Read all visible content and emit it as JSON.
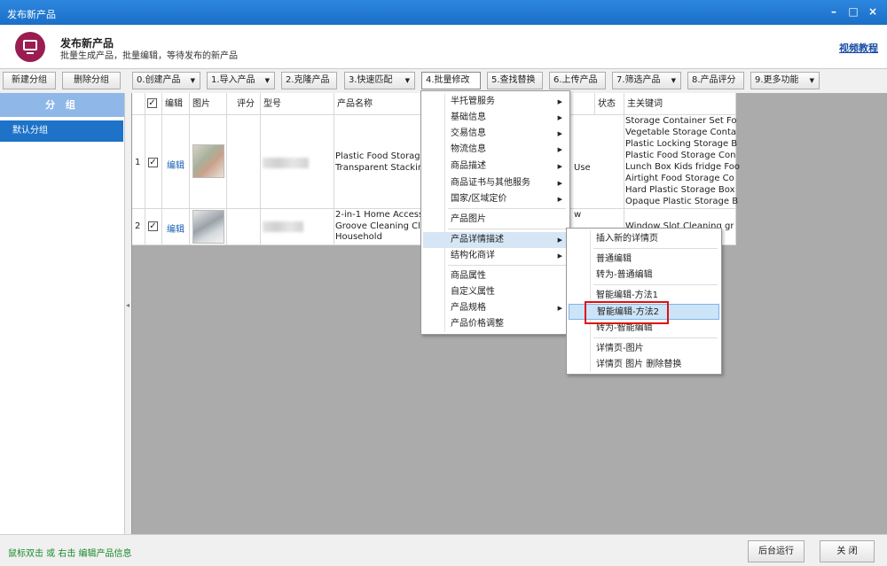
{
  "window": {
    "title": "发布新产品",
    "minimize": "–",
    "maximize": "□",
    "close": "×"
  },
  "header": {
    "title": "发布新产品",
    "subtitle": "批量生成产品，批量编辑，等待发布的新产品",
    "help_link": "视频教程"
  },
  "left_toolbar": {
    "new_group": "新建分组",
    "delete_group": "删除分组"
  },
  "toolbar": [
    {
      "label": "0.创建产品",
      "dropdown": true
    },
    {
      "label": "1.导入产品",
      "dropdown": true
    },
    {
      "label": "2.克隆产品",
      "dropdown": false
    },
    {
      "label": "3.快速匹配",
      "dropdown": true
    },
    {
      "label": "4.批量修改",
      "dropdown": false
    },
    {
      "label": "5.查找替换",
      "dropdown": false
    },
    {
      "label": "6.上传产品",
      "dropdown": false
    },
    {
      "label": "7.筛选产品",
      "dropdown": true
    },
    {
      "label": "8.产品评分",
      "dropdown": false
    },
    {
      "label": "9.更多功能",
      "dropdown": true
    }
  ],
  "groups": {
    "header": "分 组",
    "items": [
      "默认分组"
    ]
  },
  "table": {
    "headers": {
      "edit": "编辑",
      "image": "图片",
      "score": "评分",
      "model": "型号",
      "name": "产品名称",
      "status": "状态",
      "keywords": "主关键词"
    },
    "header_checked": true,
    "rows": [
      {
        "index": "1",
        "checked": true,
        "edit": "编辑",
        "name_lines": [
          "Plastic Food Storage",
          "Transparent Stacking"
        ],
        "extra": "Use",
        "keywords": [
          "Storage Container Set Fo",
          "Vegetable Storage Conta",
          "Plastic Locking Storage B",
          "Plastic Food Storage Con",
          "Lunch Box Kids fridge Foo",
          "Airtight Food Storage Co",
          "Hard Plastic Storage Box",
          "Opaque Plastic Storage B"
        ]
      },
      {
        "index": "2",
        "checked": true,
        "edit": "编辑",
        "name_lines": [
          "2-in-1 Home Access",
          "Groove Cleaning Clo",
          "Household"
        ],
        "extra": "w",
        "keywords": [
          "Window Slot Cleaning gr"
        ]
      }
    ]
  },
  "context_menu": {
    "items": [
      {
        "label": "半托管服务",
        "submenu": true
      },
      {
        "label": "基础信息",
        "submenu": true
      },
      {
        "label": "交易信息",
        "submenu": true
      },
      {
        "label": "物流信息",
        "submenu": true
      },
      {
        "label": "商品描述",
        "submenu": true
      },
      {
        "label": "商品证书与其他服务",
        "submenu": true
      },
      {
        "label": "国家/区域定价",
        "submenu": true
      },
      {
        "label": "产品图片",
        "submenu": false
      },
      {
        "label": "产品详情描述",
        "submenu": true
      },
      {
        "label": "结构化商详",
        "submenu": true
      },
      {
        "label": "商品属性",
        "submenu": false
      },
      {
        "label": "自定义属性",
        "submenu": false
      },
      {
        "label": "产品规格",
        "submenu": true
      },
      {
        "label": "产品价格调整",
        "submenu": false
      }
    ]
  },
  "submenu": {
    "items": [
      "插入新的详情页",
      "普通编辑",
      "转为-普通编辑",
      "智能编辑-方法1",
      "智能编辑-方法2",
      "转为-智能编辑",
      "详情页-图片",
      "详情页 图片 删除替换"
    ]
  },
  "statusbar": {
    "hint": "鼠标双击 或 右击 编辑产品信息",
    "background_run": "后台运行",
    "close": "关 闭"
  },
  "colors": {
    "titlebar": "#1f78d1",
    "accent": "#1e73c8",
    "highlight_box": "#e01010",
    "status_text": "#1a8a2a"
  }
}
